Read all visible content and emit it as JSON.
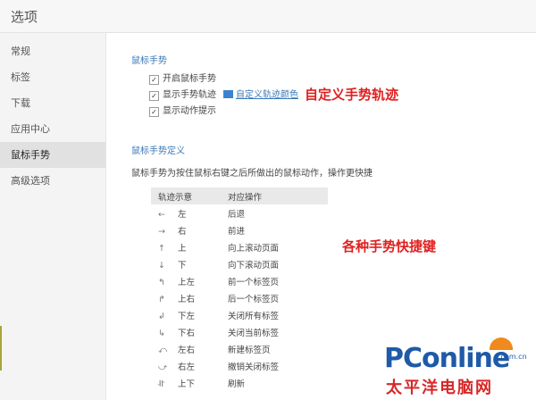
{
  "window": {
    "title": "选项"
  },
  "sidebar": {
    "items": [
      {
        "label": "常规",
        "active": false
      },
      {
        "label": "标签",
        "active": false
      },
      {
        "label": "下载",
        "active": false
      },
      {
        "label": "应用中心",
        "active": false
      },
      {
        "label": "鼠标手势",
        "active": true
      },
      {
        "label": "高级选项",
        "active": false
      }
    ]
  },
  "mouse_gesture": {
    "section_title": "鼠标手势",
    "options": [
      {
        "label": "开启鼠标手势",
        "checked": true
      },
      {
        "label": "显示手势轨迹",
        "checked": true
      },
      {
        "label": "显示动作提示",
        "checked": true
      }
    ],
    "custom_color_link": "自定义轨迹颜色",
    "swatch_color": "#3c82d0"
  },
  "annotations": {
    "trail": "自定义手势轨迹",
    "shortcuts": "各种手势快捷键"
  },
  "gesture_definition": {
    "section_title": "鼠标手势定义",
    "description": "鼠标手势为按住鼠标右键之后所做出的鼠标动作，操作更快捷",
    "columns": [
      "轨迹示意",
      "对应操作"
    ],
    "rows": [
      {
        "arrow": "←",
        "direction": "左",
        "action": "后退"
      },
      {
        "arrow": "→",
        "direction": "右",
        "action": "前进"
      },
      {
        "arrow": "↑",
        "direction": "上",
        "action": "向上滚动页面"
      },
      {
        "arrow": "↓",
        "direction": "下",
        "action": "向下滚动页面"
      },
      {
        "arrow": "↰",
        "direction": "上左",
        "action": "前一个标签页"
      },
      {
        "arrow": "↱",
        "direction": "上右",
        "action": "后一个标签页"
      },
      {
        "arrow": "↲",
        "direction": "下左",
        "action": "关闭所有标签"
      },
      {
        "arrow": "↳",
        "direction": "下右",
        "action": "关闭当前标签"
      },
      {
        "arrow": "⤺",
        "direction": "左右",
        "action": "新建标签页"
      },
      {
        "arrow": "⤻",
        "direction": "右左",
        "action": "撤销关闭标签"
      },
      {
        "arrow": "⥯",
        "direction": "上下",
        "action": "刷新"
      }
    ]
  },
  "watermark": {
    "brand": "PConline",
    "domain": ".com.cn",
    "subtitle": "太平洋电脑网"
  }
}
